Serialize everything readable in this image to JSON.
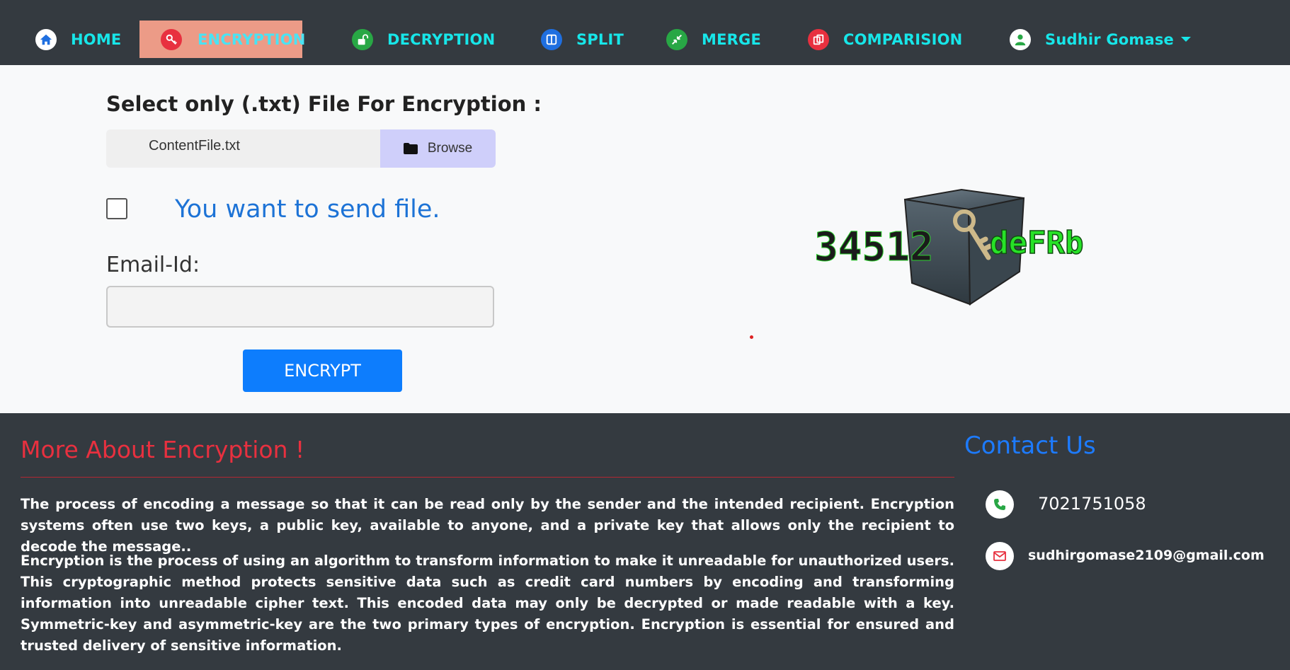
{
  "nav": {
    "items": [
      {
        "label": "HOME",
        "icon": "home-icon"
      },
      {
        "label": "ENCRYPTION",
        "icon": "key-icon",
        "active": true
      },
      {
        "label": "DECRYPTION",
        "icon": "unlock-icon"
      },
      {
        "label": "SPLIT",
        "icon": "columns-icon"
      },
      {
        "label": "MERGE",
        "icon": "compress-icon"
      },
      {
        "label": "COMPARISION",
        "icon": "copy-icon"
      }
    ],
    "user": {
      "name": "Sudhir Gomase",
      "icon": "user-icon"
    }
  },
  "form": {
    "file_label": "Select only (.txt) File For Encryption :",
    "file_name": "ContentFile.txt",
    "browse_label": "Browse",
    "send_label": "You want to send file.",
    "send_checked": false,
    "email_label": "Email-Id:",
    "email_value": "",
    "encrypt_label": "ENCRYPT"
  },
  "graphic": {
    "text_left": "34512",
    "text_right": "deFRb"
  },
  "footer": {
    "about_title": "More About Encryption !",
    "para1": "The process of encoding a message so that it can be read only by the sender and the intended recipient. Encryption systems often use two keys, a public key, available to anyone, and a private key that allows only the recipient to decode the message..",
    "para2": "Encryption is the process of using an algorithm to transform information to make it unreadable for unauthorized users. This cryptographic method protects sensitive data such as credit card numbers by encoding and transforming information into unreadable cipher text. This encoded data may only be decrypted or made readable with a key. Symmetric-key and asymmetric-key are the two primary types of encryption. Encryption is essential for ensured and trusted delivery of sensitive information.",
    "contact_title": "Contact Us",
    "phone": "7021751058",
    "email": "sudhirgomase2109@gmail.com"
  },
  "colors": {
    "navbar_bg": "#343a40",
    "nav_text": "#17e6e9",
    "active_bg": "#ec9b87",
    "primary": "#0d7dfd",
    "about_title": "#e8303f",
    "contact_title": "#1d7bff"
  }
}
